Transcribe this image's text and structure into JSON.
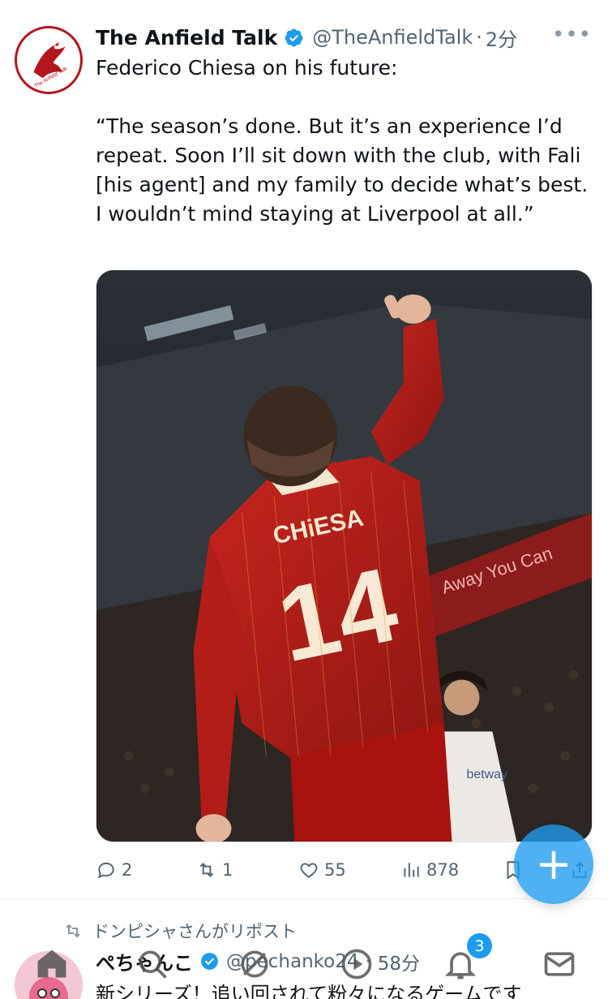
{
  "tweet": {
    "display_name": "The Anfield Talk",
    "handle": "@TheAnfieldTalk",
    "separator": "·",
    "time": "2分",
    "more_label": "•••",
    "text": "Federico Chiesa on his future:\n\n“The season’s done. But it’s an experience I’d repeat. Soon I’ll sit down with the club, with Fali [his agent] and my family to decide what’s best. I wouldn’t mind staying at Liverpool at all.”",
    "avatar_text": "The Anfield Talk",
    "media": {
      "jersey_name": "CHiESA",
      "jersey_number": "14",
      "ad_text": "Away You Can",
      "sponsor_text": "betway"
    },
    "metrics": {
      "replies": "2",
      "retweets": "1",
      "likes": "55",
      "views": "878"
    }
  },
  "next_tweet": {
    "repost_text": "ドンピシャさんがリポスト",
    "display_name": "ぺちゃんこ",
    "handle": "@pechanko24",
    "separator": "·",
    "time": "58分",
    "text": "新シリーズ！追い回されて粉々になるゲームです"
  },
  "fab": {
    "label": "+"
  },
  "tabbar": {
    "notifications_badge": "3",
    "items": [
      "home-icon",
      "search-icon",
      "grok-icon",
      "spaces-icon",
      "notifications-icon",
      "messages-icon"
    ]
  },
  "colors": {
    "accent": "#1d9bf0",
    "liverpool_red": "#b3161c",
    "text_secondary": "#536471"
  }
}
